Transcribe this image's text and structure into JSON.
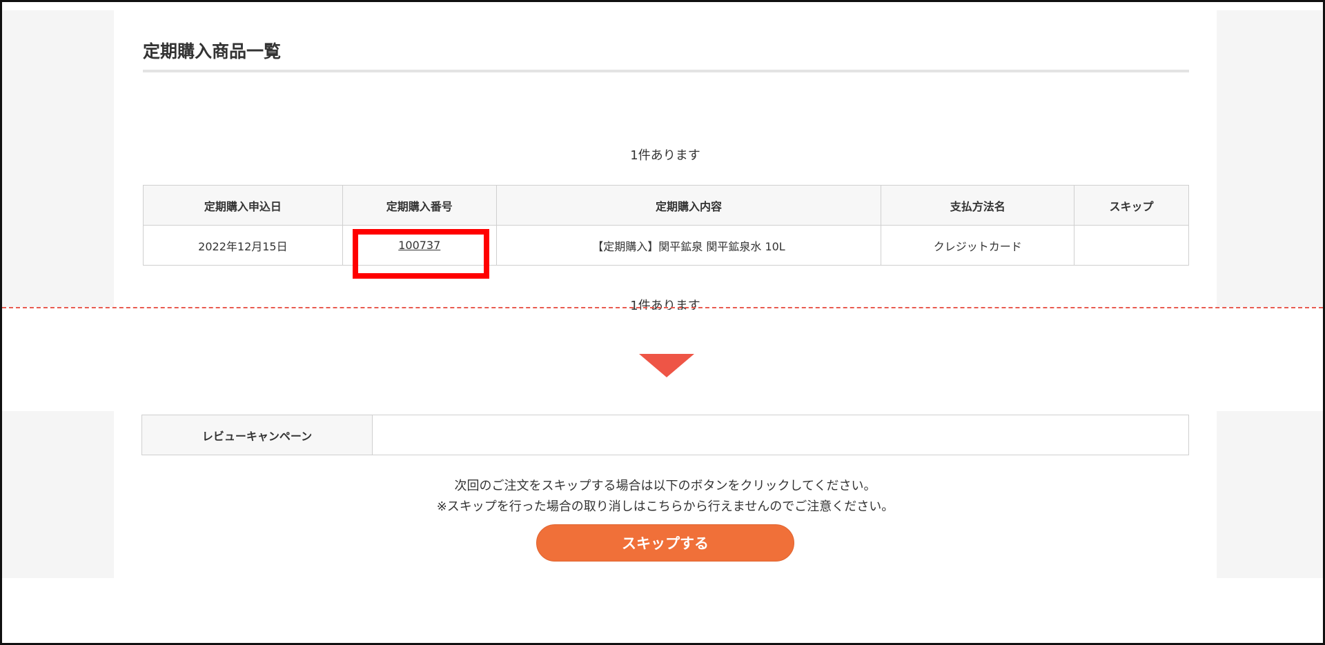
{
  "page": {
    "title": "定期購入商品一覧",
    "count_text": "1件あります"
  },
  "subscription_table": {
    "headers": [
      "定期購入申込日",
      "定期購入番号",
      "定期購入内容",
      "支払方法名",
      "スキップ"
    ],
    "rows": [
      {
        "date": "2022年12月15日",
        "number": "100737",
        "content": "【定期購入】関平鉱泉 関平鉱泉水 10L",
        "payment": "クレジットカード",
        "skip": ""
      }
    ]
  },
  "review": {
    "label": "レビューキャンペーン",
    "value": ""
  },
  "notice": {
    "line1": "次回のご注文をスキップする場合は以下のボタンをクリックしてください。",
    "line2": "※スキップを行った場合の取り消しはこちらから行えませんのでご注意ください。"
  },
  "skip_button": {
    "label": "スキップする"
  },
  "colors": {
    "highlight": "#ff0000",
    "divider": "#e85a4f",
    "arrow": "#ee5546",
    "button": "#f07039"
  }
}
